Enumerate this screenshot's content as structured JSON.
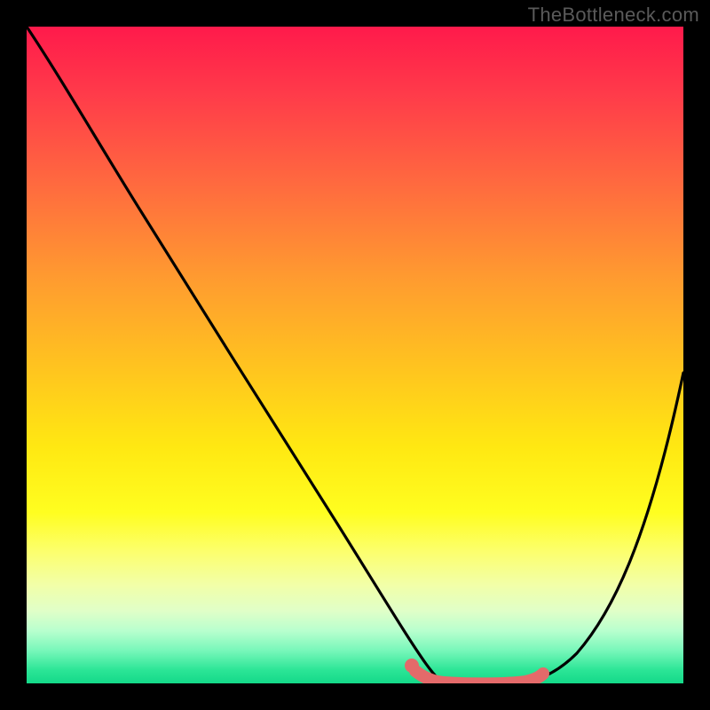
{
  "watermark": "TheBottleneck.com",
  "colors": {
    "frame": "#000000",
    "curve": "#000000",
    "highlight": "#e46a6a",
    "highlight_dot": "#e46a6a"
  },
  "chart_data": {
    "type": "line",
    "title": "",
    "xlabel": "",
    "ylabel": "",
    "xlim": [
      0,
      100
    ],
    "ylim": [
      0,
      100
    ],
    "grid": false,
    "series": [
      {
        "name": "bottleneck-curve-left",
        "x": [
          0,
          4,
          10,
          18,
          26,
          34,
          42,
          50,
          55,
          58,
          60,
          62
        ],
        "y": [
          100,
          94,
          85,
          73,
          61,
          49,
          37,
          24,
          15,
          8,
          3,
          0
        ]
      },
      {
        "name": "bottleneck-curve-right",
        "x": [
          62,
          68,
          74,
          78,
          82,
          86,
          90,
          94,
          98,
          100
        ],
        "y": [
          0,
          0,
          0,
          2,
          6,
          12,
          20,
          30,
          42,
          50
        ]
      }
    ],
    "highlight_segment": {
      "x_start": 58,
      "x_end": 77,
      "y": 1
    },
    "highlight_dot": {
      "x": 58,
      "y": 3
    },
    "gradient_stops": [
      {
        "pct": 0,
        "color": "#ff1a4b"
      },
      {
        "pct": 24,
        "color": "#ff6a3f"
      },
      {
        "pct": 52,
        "color": "#ffc41f"
      },
      {
        "pct": 74,
        "color": "#fffe20"
      },
      {
        "pct": 92,
        "color": "#b8ffce"
      },
      {
        "pct": 100,
        "color": "#14d989"
      }
    ]
  }
}
